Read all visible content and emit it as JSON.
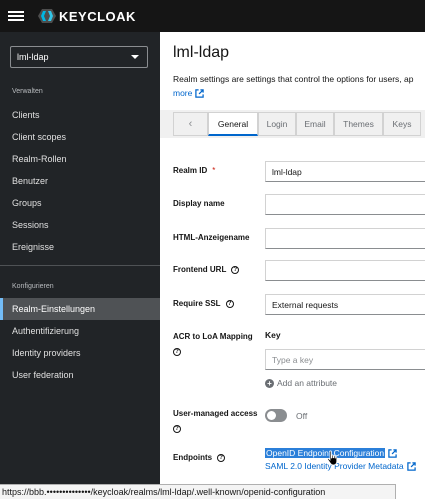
{
  "brand": {
    "name": "KEYCLOAK"
  },
  "sidebar": {
    "realm": "lml-ldap",
    "sections": [
      {
        "title": "Verwalten"
      },
      {
        "title": "Konfigurieren"
      }
    ],
    "manage_items": [
      {
        "label": "Clients"
      },
      {
        "label": "Client scopes"
      },
      {
        "label": "Realm-Rollen"
      },
      {
        "label": "Benutzer"
      },
      {
        "label": "Groups"
      },
      {
        "label": "Sessions"
      },
      {
        "label": "Ereignisse"
      }
    ],
    "configure_items": [
      {
        "label": "Realm-Einstellungen",
        "active": true
      },
      {
        "label": "Authentifizierung"
      },
      {
        "label": "Identity providers"
      },
      {
        "label": "User federation"
      }
    ]
  },
  "header": {
    "title": "lml-ldap",
    "description": "Realm settings are settings that control the options for users, ap",
    "more_label": "more"
  },
  "tabs": [
    {
      "label": "General",
      "active": true
    },
    {
      "label": "Login"
    },
    {
      "label": "Email"
    },
    {
      "label": "Themes"
    },
    {
      "label": "Keys"
    }
  ],
  "form": {
    "realm_id": {
      "label": "Realm ID",
      "required_mark": "*",
      "value": "lml-ldap"
    },
    "display_name": {
      "label": "Display name",
      "value": ""
    },
    "html_display_name": {
      "label": "HTML-Anzeigename",
      "value": ""
    },
    "frontend_url": {
      "label": "Frontend URL",
      "value": ""
    },
    "require_ssl": {
      "label": "Require SSL",
      "value": "External requests"
    },
    "acr_loa": {
      "label_line1": "ACR to LoA Mapping",
      "key_header": "Key",
      "key_placeholder": "Type a key",
      "add_attribute": "Add an attribute"
    },
    "user_managed_access": {
      "label": "User-managed access",
      "state": "Off"
    },
    "endpoints": {
      "label": "Endpoints",
      "links": [
        {
          "label": "OpenID Endpoint Configuration",
          "selected": true
        },
        {
          "label": "SAML 2.0 Identity Provider Metadata"
        }
      ]
    }
  },
  "statusbar": {
    "url": "https://bbb.••••••••••••••/keycloak/realms/lml-ldap/.well-known/openid-configuration"
  },
  "colors": {
    "sidebar_bg": "#212427",
    "topbar_bg": "#151515",
    "accent": "#06c",
    "active_nav_border": "#73bcf7",
    "required": "#c9190b"
  }
}
